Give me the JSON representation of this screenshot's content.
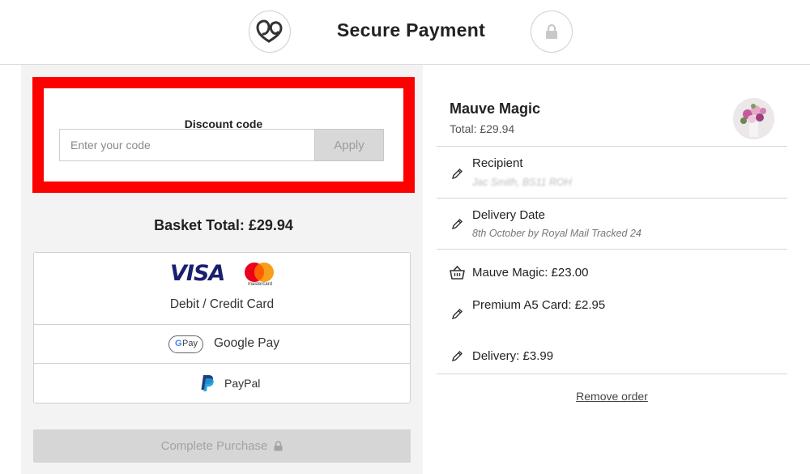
{
  "header": {
    "title": "Secure Payment",
    "logo_icon": "heart-logo-icon",
    "lock_icon": "lock-icon"
  },
  "discount": {
    "label": "Discount code",
    "placeholder": "Enter your code",
    "value": "",
    "apply_label": "Apply"
  },
  "basket": {
    "total_text": "Basket Total: £29.94"
  },
  "payment_methods": {
    "card": {
      "brand_visa": "VISA",
      "brand_mastercard": "mastercard",
      "label": "Debit / Credit Card"
    },
    "google_pay": {
      "badge_g": "G",
      "badge_pay": "Pay",
      "label": "Google Pay"
    },
    "paypal": {
      "label": "PayPal"
    }
  },
  "complete_purchase": {
    "label": "Complete Purchase"
  },
  "order": {
    "product_name": "Mauve Magic",
    "total": "Total: £29.94",
    "recipient": {
      "title": "Recipient",
      "value": "Jac Smith, BS11 ROH"
    },
    "delivery_date": {
      "title": "Delivery Date",
      "value": "8th October by Royal Mail Tracked 24"
    },
    "line_items": [
      {
        "label": "Mauve Magic: £23.00",
        "icon": "basket-icon"
      },
      {
        "label": "Premium A5 Card: £2.95",
        "icon": "pencil-icon"
      },
      {
        "label": "Delivery: £3.99",
        "icon": "pencil-icon"
      }
    ],
    "remove_label": "Remove order"
  },
  "colors": {
    "highlight_border": "#ff0000",
    "panel_bg": "#f3f3f3",
    "visa_blue": "#1a1f71",
    "mc_red": "#eb001b",
    "mc_orange": "#f79e1b"
  }
}
